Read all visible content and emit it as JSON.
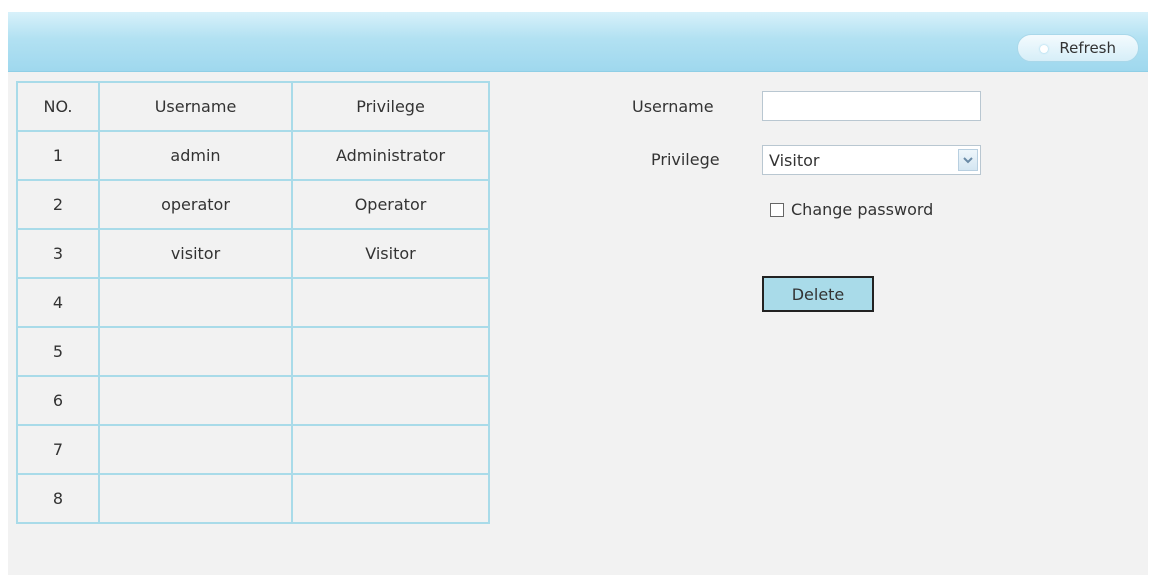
{
  "header": {
    "refresh_label": "Refresh"
  },
  "table": {
    "headers": [
      "NO.",
      "Username",
      "Privilege"
    ],
    "rows": [
      {
        "no": "1",
        "username": "admin",
        "privilege": "Administrator"
      },
      {
        "no": "2",
        "username": "operator",
        "privilege": "Operator"
      },
      {
        "no": "3",
        "username": "visitor",
        "privilege": "Visitor"
      },
      {
        "no": "4",
        "username": "",
        "privilege": ""
      },
      {
        "no": "5",
        "username": "",
        "privilege": ""
      },
      {
        "no": "6",
        "username": "",
        "privilege": ""
      },
      {
        "no": "7",
        "username": "",
        "privilege": ""
      },
      {
        "no": "8",
        "username": "",
        "privilege": ""
      }
    ]
  },
  "form": {
    "username_label": "Username",
    "username_value": "",
    "privilege_label": "Privilege",
    "privilege_value": "Visitor",
    "change_password_label": "Change password",
    "change_password_checked": false,
    "delete_label": "Delete"
  },
  "colors": {
    "header_bar": "#b2e1f2",
    "table_border": "#a9dbe9",
    "panel_bg": "#f2f2f2",
    "delete_button_bg": "#a9dbe9"
  },
  "icons": {
    "refresh": "refresh-dot-icon",
    "select": "chevron-down-icon"
  }
}
